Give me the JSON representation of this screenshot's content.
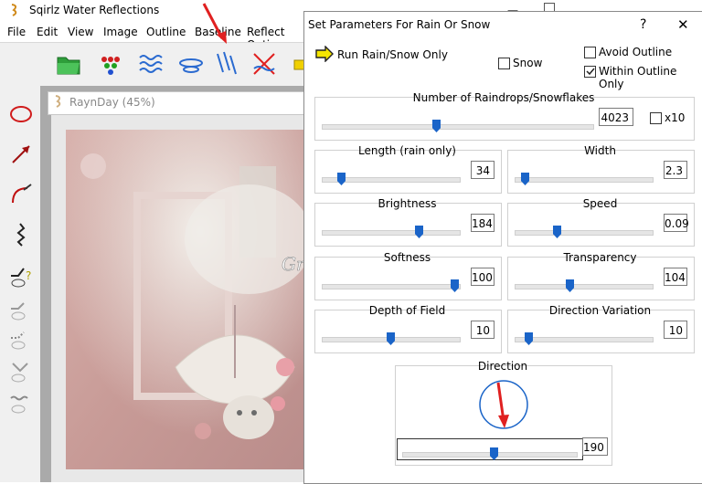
{
  "app": {
    "title": "Sqirlz Water Reflections",
    "menu": [
      "File",
      "Edit",
      "View",
      "Image",
      "Outline",
      "Baseline",
      "Reflect Opti"
    ]
  },
  "document": {
    "title": "RaynDay",
    "zoom": "(45%)",
    "watermark": "Graficamia"
  },
  "dialog": {
    "title": "Set Parameters For Rain Or Snow",
    "help": "?",
    "close": "✕",
    "mode_label": "Run Rain/Snow Only",
    "snow_label": "Snow",
    "snow_checked": false,
    "avoid_outline_label": "Avoid Outline",
    "avoid_outline_checked": false,
    "within_outline_label": "Within Outline Only",
    "within_outline_checked": true,
    "raindrops": {
      "label": "Number of Raindrops/Snowflakes",
      "value": "4023",
      "x10_label": "x10",
      "x10_checked": false,
      "fraction": 0.42
    },
    "sliders": [
      {
        "key": "length",
        "label": "Length (rain only)",
        "value": "34",
        "fraction": 0.12
      },
      {
        "key": "width",
        "label": "Width",
        "value": "2.3",
        "fraction": 0.05
      },
      {
        "key": "brightness",
        "label": "Brightness",
        "value": "184",
        "fraction": 0.72
      },
      {
        "key": "speed",
        "label": "Speed",
        "value": "0.09",
        "fraction": 0.3
      },
      {
        "key": "softness",
        "label": "Softness",
        "value": "100",
        "fraction": 1.0
      },
      {
        "key": "transparency",
        "label": "Transparency",
        "value": "104",
        "fraction": 0.4
      },
      {
        "key": "depth",
        "label": "Depth of Field",
        "value": "10",
        "fraction": 0.5
      },
      {
        "key": "dirvar",
        "label": "Direction Variation",
        "value": "10",
        "fraction": 0.08
      }
    ],
    "direction": {
      "label": "Direction",
      "value": "190",
      "fraction": 0.53
    }
  },
  "colors": {
    "accent": "#1a64c8",
    "annotation_red": "#e02020",
    "photo_pink": "#c9a3a0"
  }
}
